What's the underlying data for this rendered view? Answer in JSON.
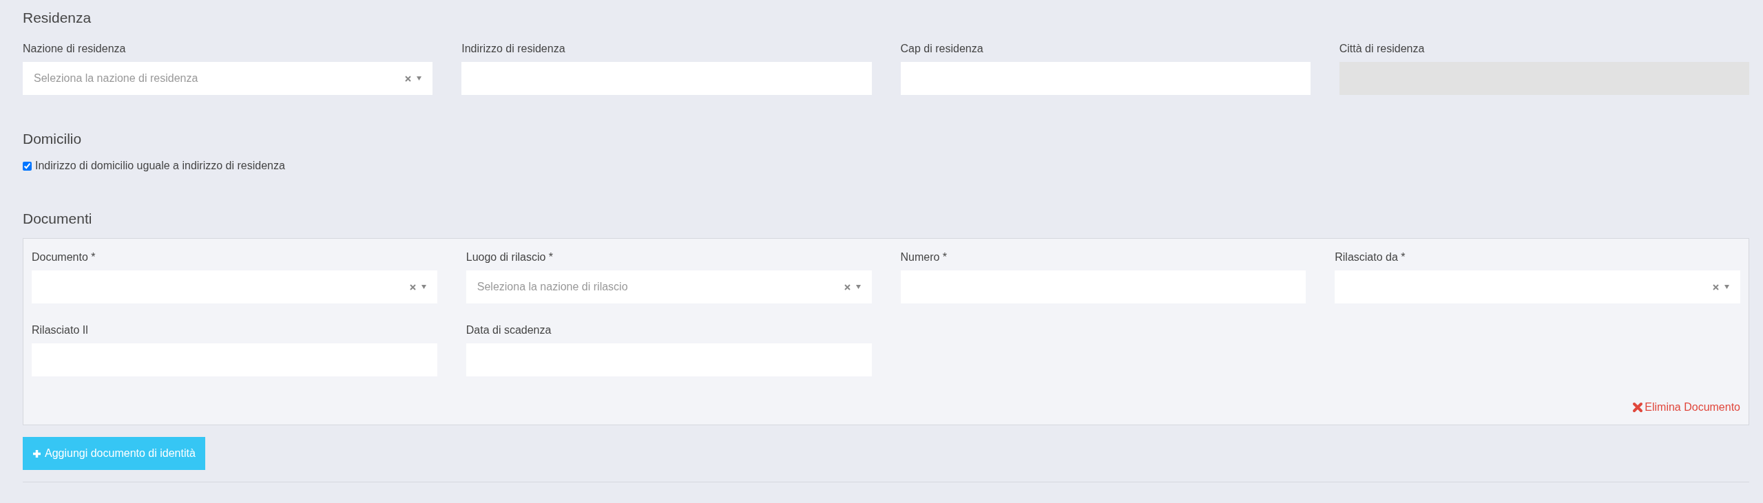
{
  "residenza": {
    "title": "Residenza",
    "fields": [
      {
        "label": "Nazione di residenza",
        "kind": "select",
        "placeholder": "Seleziona la nazione di residenza",
        "disabled": false
      },
      {
        "label": "Indirizzo di residenza",
        "kind": "text",
        "disabled": false
      },
      {
        "label": "Cap di residenza",
        "kind": "text",
        "disabled": false
      },
      {
        "label": "Città di residenza",
        "kind": "text",
        "disabled": true
      }
    ]
  },
  "domicilio": {
    "title": "Domicilio",
    "checkbox": {
      "label": "Indirizzo di domicilio uguale a indirizzo di residenza",
      "checked": true
    }
  },
  "documenti": {
    "title": "Documenti",
    "fields": [
      {
        "label": "Documento *",
        "kind": "select",
        "disabled": false
      },
      {
        "label": "Luogo di rilascio *",
        "kind": "select",
        "placeholder": "Seleziona la nazione di rilascio",
        "disabled": false
      },
      {
        "label": "Numero *",
        "kind": "text",
        "disabled": false
      },
      {
        "label": "Rilasciato da *",
        "kind": "select",
        "disabled": false
      },
      {
        "label": "Rilasciato Il",
        "kind": "text",
        "disabled": false
      },
      {
        "label": "Data di scadenza",
        "kind": "text",
        "disabled": false
      }
    ],
    "delete_link": "Elimina Documento",
    "add_button": "Aggiungi documento di identità"
  }
}
